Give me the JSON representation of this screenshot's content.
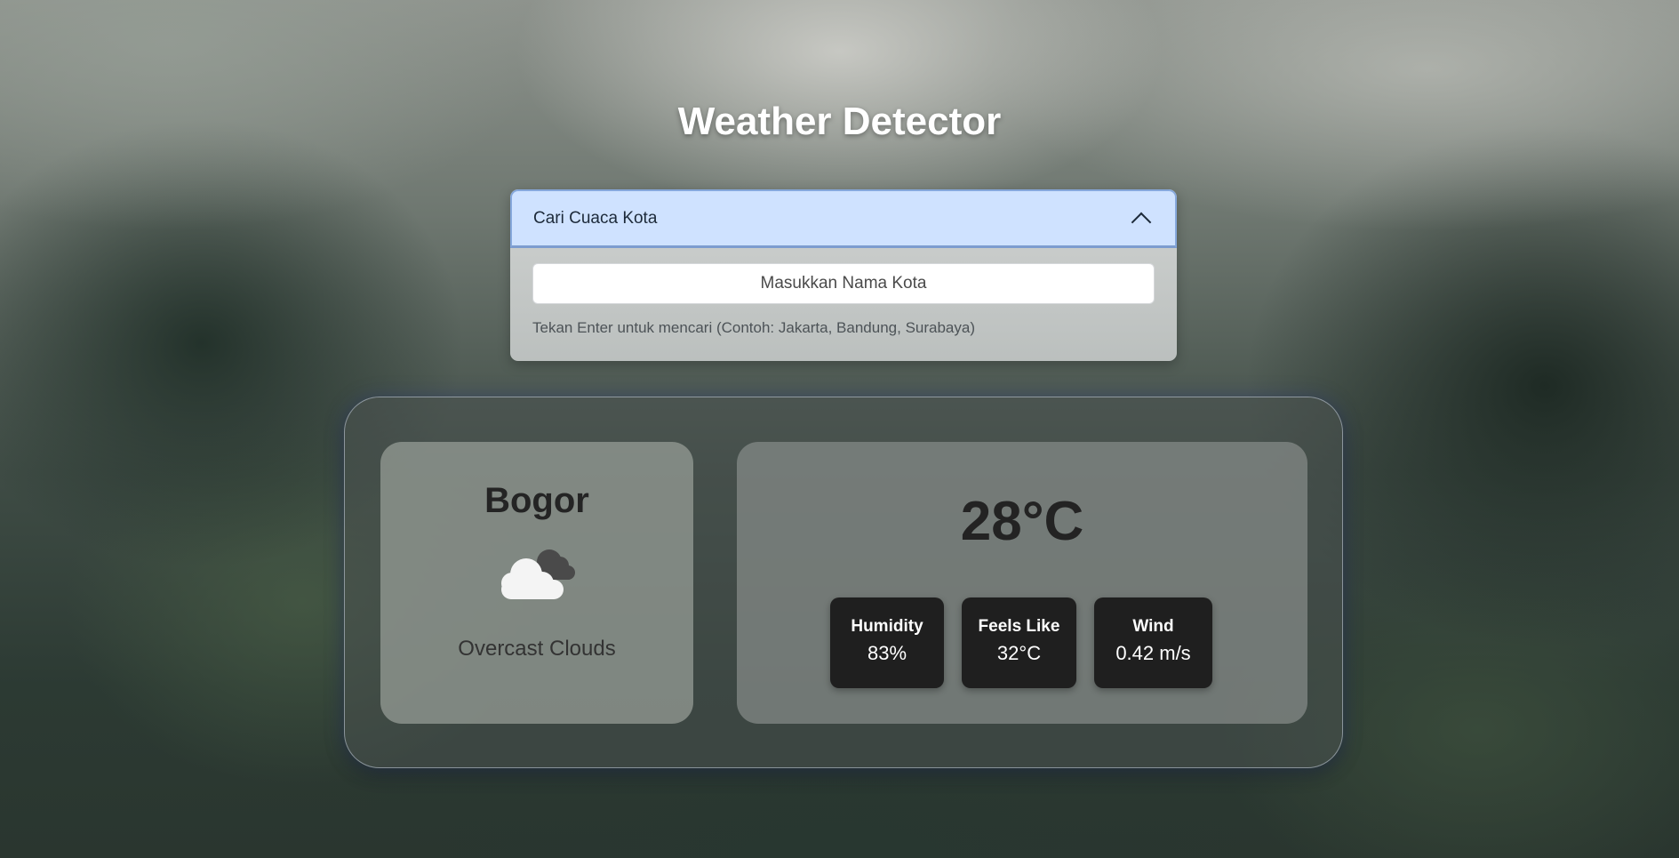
{
  "app": {
    "title": "Weather Detector"
  },
  "search": {
    "accordion_label": "Cari Cuaca Kota",
    "accordion_state": "expanded",
    "input_placeholder": "Masukkan Nama Kota",
    "input_value": "",
    "hint": "Tekan Enter untuk mencari (Contoh: Jakarta, Bandung, Surabaya)"
  },
  "weather": {
    "city": "Bogor",
    "icon": "overcast-clouds-icon",
    "description": "Overcast Clouds",
    "temperature": "28°C",
    "stats": [
      {
        "label": "Humidity",
        "value": "83%"
      },
      {
        "label": "Feels Like",
        "value": "32°C"
      },
      {
        "label": "Wind",
        "value": "0.42 m/s"
      }
    ]
  },
  "colors": {
    "accordion_header": "#cfe2ff",
    "stat_box": "#1f1f1f",
    "title_text": "#ffffff"
  }
}
